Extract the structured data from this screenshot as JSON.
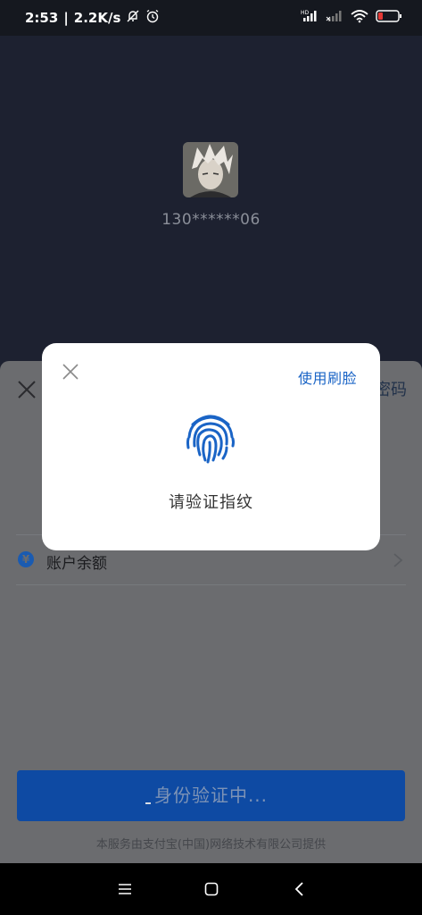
{
  "status_bar": {
    "time": "2:53",
    "separator": "|",
    "net_speed": "2.2K/s",
    "icons": [
      "notifications-off-icon",
      "alarm-icon",
      "hd-signal-icon",
      "signal-icon",
      "wifi-icon",
      "battery-icon"
    ],
    "battery_color": "#e53935"
  },
  "account": {
    "masked_phone": "130******06"
  },
  "sheet": {
    "right_partial_text": "密码",
    "balance_label": "账户余额",
    "yuan_symbol": "¥",
    "verify_button_label": "身份验证中...",
    "footer": "本服务由支付宝(中国)网络技术有限公司提供"
  },
  "dialog": {
    "switch_link": "使用刷脸",
    "message": "请验证指纹",
    "accent_color": "#1a64c6"
  },
  "nav": {
    "items": [
      "menu-icon",
      "home-icon",
      "back-icon"
    ]
  }
}
